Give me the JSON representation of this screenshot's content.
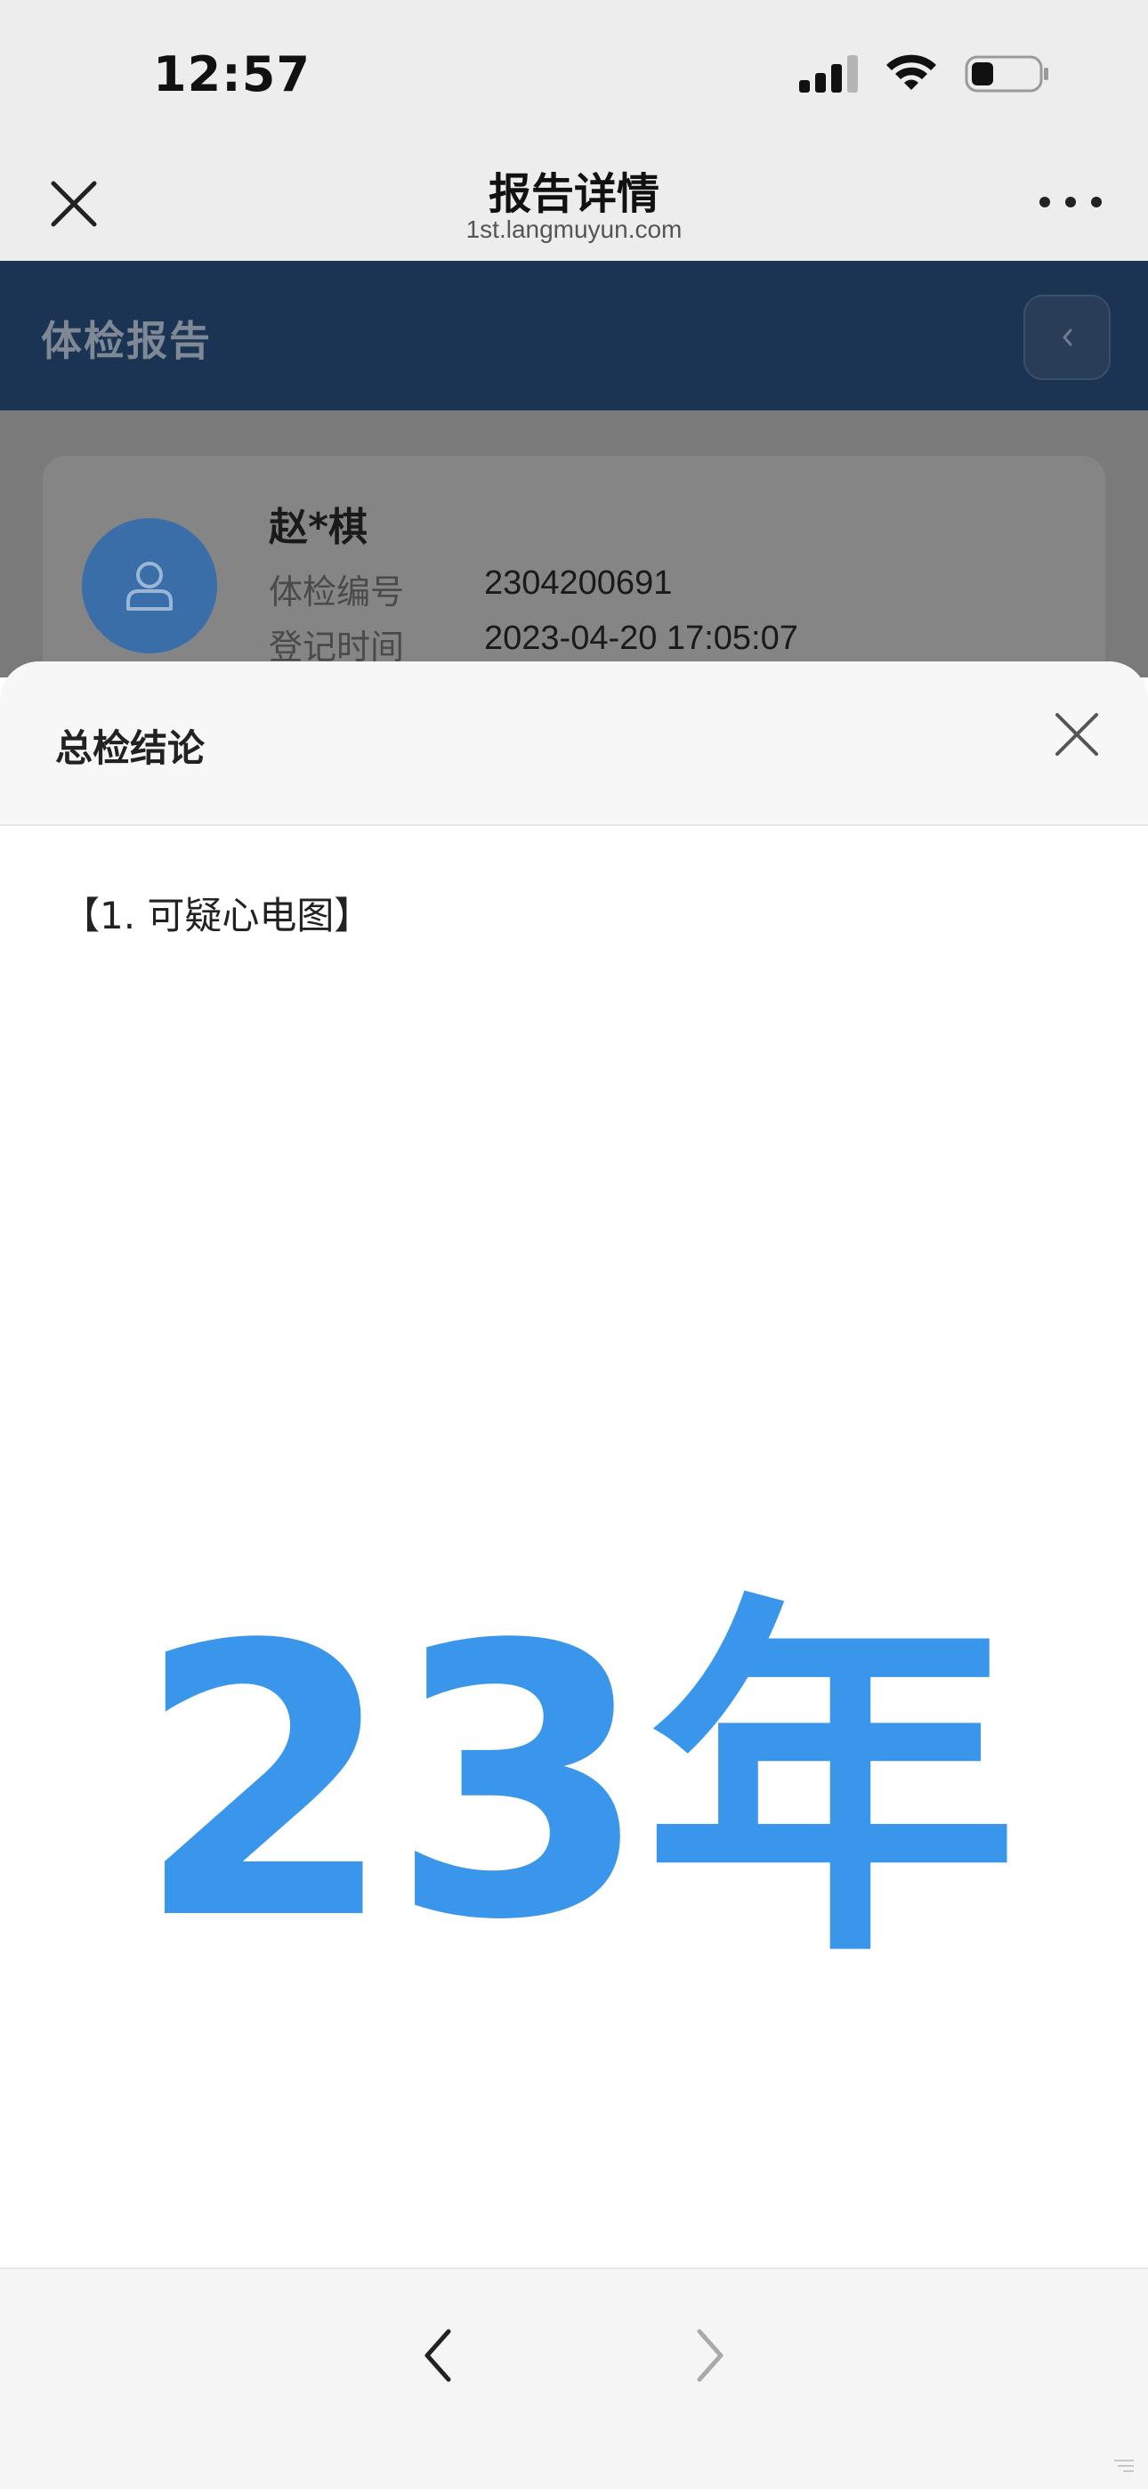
{
  "status_bar": {
    "time": "12:57"
  },
  "nav": {
    "title": "报告详情",
    "url": "1st.langmuyun.com"
  },
  "header": {
    "title": "体检报告"
  },
  "patient": {
    "name": "赵*棋",
    "exam_number_label": "体检编号",
    "exam_number": "2304200691",
    "register_time_label": "登记时间",
    "register_time": "2023-04-20 17:05:07"
  },
  "sheet": {
    "title": "总检结论",
    "content": "【1. 可疑心电图】",
    "watermark": "23年"
  },
  "colors": {
    "header_bg": "#1c3454",
    "avatar_bg": "#3a6ea8",
    "watermark": "#3a96ea"
  },
  "icons": [
    "close-icon",
    "more-icon",
    "back-icon",
    "user-icon",
    "chevron-left-icon",
    "chevron-right-icon",
    "signal-icon",
    "wifi-icon",
    "battery-icon"
  ]
}
